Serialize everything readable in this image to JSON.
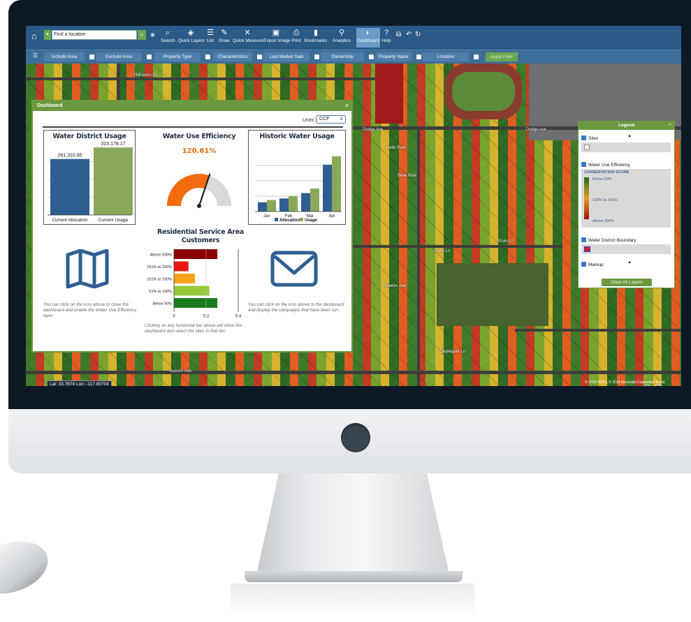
{
  "toolbar": {
    "location_placeholder": "Find a location",
    "buttons": [
      {
        "label": "Search",
        "icon": "magnifier"
      },
      {
        "label": "Quick Layers",
        "icon": "layers"
      },
      {
        "label": "List",
        "icon": "list"
      },
      {
        "label": "Draw",
        "icon": "pencil"
      },
      {
        "label": "Quick Measure",
        "icon": "measure"
      },
      {
        "label": "Export Image",
        "icon": "image"
      },
      {
        "label": "Print",
        "icon": "printer"
      },
      {
        "label": "Bookmarks",
        "icon": "bookmark"
      },
      {
        "label": "Analytics",
        "icon": "pin"
      },
      {
        "label": "Dashboard",
        "icon": "dashboard"
      },
      {
        "label": "Help",
        "icon": "question"
      }
    ]
  },
  "filters": [
    "Include Area",
    "Exclude Area",
    "Property Type",
    "Characteristics",
    "Last Market Sale",
    "Ownership",
    "Property Value",
    "Location"
  ],
  "apply_filter": "Apply Filter",
  "map": {
    "street_labels": [
      "Hillhaven Dr",
      "Dodge Ave",
      "Dodge Ave",
      "Belle Rive",
      "Belle Rive",
      "Ervin Ln",
      "Ervin Ln",
      "Newton Ave",
      "Castlegate Ln",
      "Auburn Ave",
      "Hillhaven Dr"
    ],
    "coords": "Lat: 33.7674 Lon: -117.80704",
    "copyright": "© 2019 HERE, © 2019 Microsoft Corporation Terms"
  },
  "dashboard": {
    "title": "Dashboard",
    "units_label": "Units:",
    "units_value": "CCF",
    "water_district_usage": {
      "title": "Water District Usage",
      "chart_data": {
        "type": "bar",
        "categories": [
          "Current Allocation",
          "Current Usage"
        ],
        "values": [
          261310.95,
          315178.17
        ],
        "value_labels": [
          "261,310.95",
          "315,178.17"
        ],
        "colors": [
          "#2e5f92",
          "#8aa85a"
        ],
        "ylim": [
          0,
          400000
        ]
      }
    },
    "water_use_efficiency": {
      "title": "Water Use Efficiency",
      "value": "120.61%",
      "chart_data": {
        "type": "gauge",
        "value": 120.61,
        "range": [
          0,
          200
        ]
      }
    },
    "historic_water_usage": {
      "title": "Historic Water Usage",
      "chart_data": {
        "type": "bar",
        "categories": [
          "Jan",
          "Feb",
          "Mar",
          "Apr"
        ],
        "series": [
          {
            "name": "Allocation",
            "values": [
              12,
              17,
              24,
              61
            ],
            "color": "#2e5f92"
          },
          {
            "name": "Usage",
            "values": [
              15,
              20,
              30,
              72
            ],
            "color": "#8aa85a"
          }
        ],
        "ylim": [
          0,
          80
        ]
      }
    },
    "residential_service": {
      "title_line1": "Residential Service Area",
      "title_line2": "Customers",
      "chart_data": {
        "type": "bar",
        "orientation": "horizontal",
        "categories": [
          "Above 200%",
          "151% to 200%",
          "101% to 150%",
          "51% to 100%",
          "Below 50%"
        ],
        "values": [
          0.27,
          0.09,
          0.13,
          0.22,
          0.27
        ],
        "colors": [
          "#8b0000",
          "#e5170f",
          "#f5a31a",
          "#97c93d",
          "#1b7a1b"
        ],
        "xticks": [
          "0",
          "0.2",
          "0.4"
        ],
        "xlim": [
          0,
          0.4
        ]
      },
      "hint": "Clicking on any horizontal bar above will close the dashboard and select the sites in that tier."
    },
    "map_hint": "You can click on the icon above to close the dashboard and enable the Water Use Efficiency layer.",
    "mail_hint": "You can click on the icon above to the dashboard and display the campaigns that have been run."
  },
  "legend": {
    "title": "Legend",
    "layers": [
      "Sites",
      "Water Use Efficiency",
      "Water District Boundary",
      "Markup"
    ],
    "conservation_title": "CONSERVATION SCORE",
    "scale": [
      "Below 50%",
      "100% to 150%",
      "Above 200%"
    ],
    "clear_button": "Clear All Layers"
  }
}
